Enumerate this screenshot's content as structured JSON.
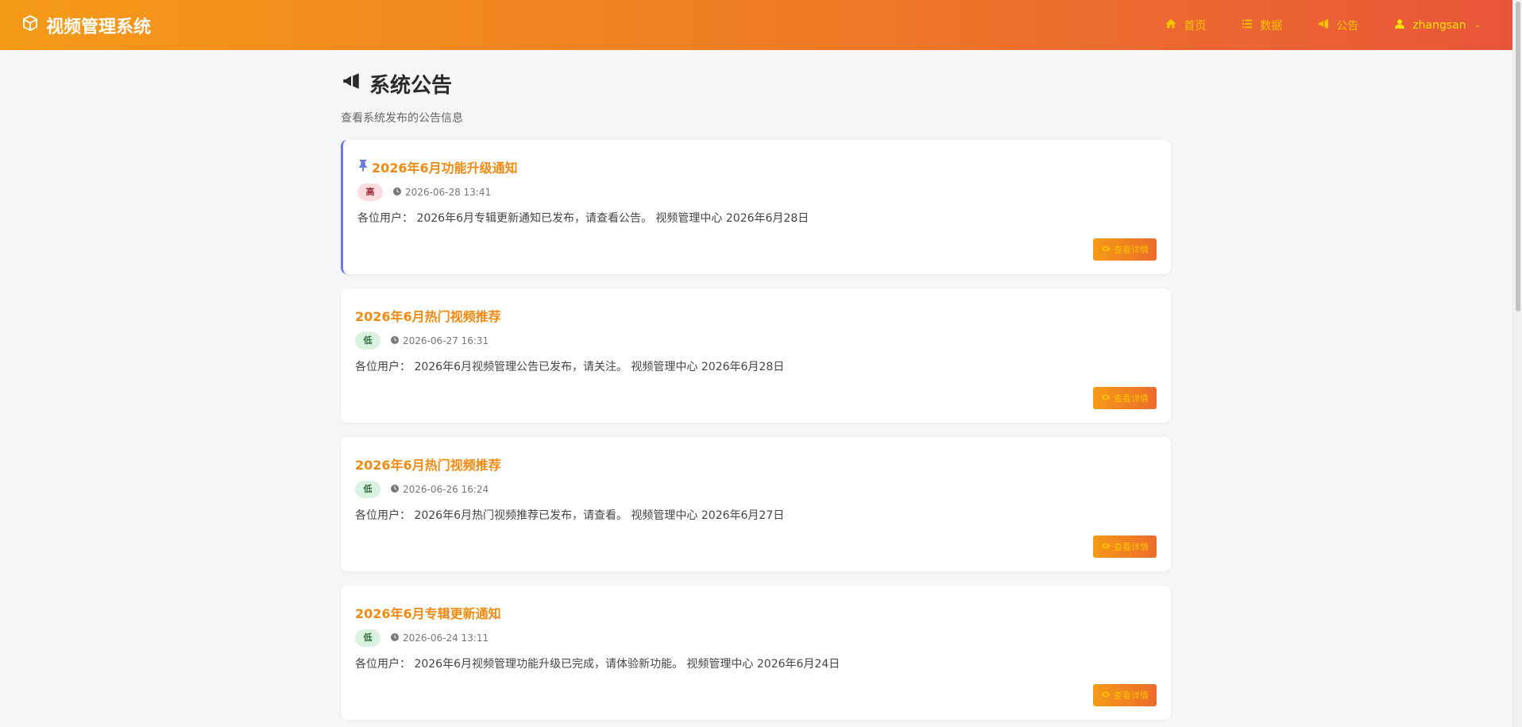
{
  "brand": {
    "title": "视频管理系统"
  },
  "nav": {
    "home": "首页",
    "data": "数据",
    "notice": "公告",
    "user": "zhangsan"
  },
  "page": {
    "title": "系统公告",
    "subtitle": "查看系统发布的公告信息"
  },
  "announcements": [
    {
      "title": "2026年6月功能升级通知",
      "priority": "高",
      "time": "2026-06-28 13:41",
      "body": "各位用户： 2026年6月专辑更新通知已发布，请查看公告。 视频管理中心 2026年6月28日",
      "button": "查看详情",
      "pinned": true
    },
    {
      "title": "2026年6月热门视频推荐",
      "priority": "低",
      "time": "2026-06-27 16:31",
      "body": "各位用户： 2026年6月视频管理公告已发布，请关注。 视频管理中心 2026年6月28日",
      "button": "查看详情",
      "pinned": false
    },
    {
      "title": "2026年6月热门视频推荐",
      "priority": "低",
      "time": "2026-06-26 16:24",
      "body": "各位用户： 2026年6月热门视频推荐已发布，请查看。 视频管理中心 2026年6月27日",
      "button": "查看详情",
      "pinned": false
    },
    {
      "title": "2026年6月专辑更新通知",
      "priority": "低",
      "time": "2026-06-24 13:11",
      "body": "各位用户： 2026年6月视频管理功能升级已完成，请体验新功能。 视频管理中心 2026年6月24日",
      "button": "查看详情",
      "pinned": false
    }
  ],
  "colors": {
    "accent": "#f08a12",
    "nav_gradient_start": "#f59a17",
    "nav_gradient_end": "#e8563a",
    "pin": "#6a7be0",
    "high_badge_bg": "#fbdde0",
    "low_badge_bg": "#d9f2df"
  }
}
